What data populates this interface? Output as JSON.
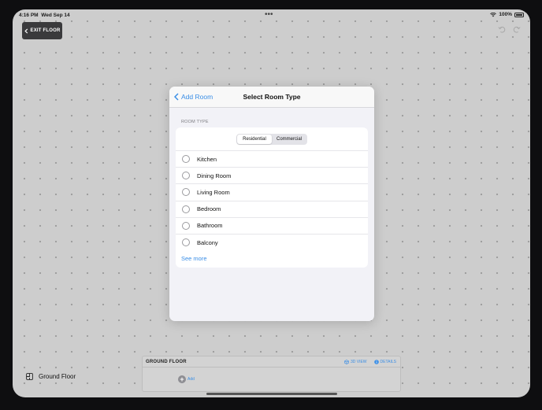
{
  "status_bar": {
    "time": "4:16 PM",
    "date": "Wed Sep 14",
    "battery": "100%",
    "dots": "•••"
  },
  "toolbar": {
    "exit_label": "EXIT FLOOR"
  },
  "dialog": {
    "back_label": "Add Room",
    "title": "Select Room Type",
    "section_label": "ROOM TYPE",
    "segments": [
      {
        "label": "Residential",
        "selected": true
      },
      {
        "label": "Commercial",
        "selected": false
      }
    ],
    "options": [
      {
        "label": "Kitchen",
        "selected": false
      },
      {
        "label": "Dining Room",
        "selected": false
      },
      {
        "label": "Living Room",
        "selected": false
      },
      {
        "label": "Bedroom",
        "selected": false
      },
      {
        "label": "Bathroom",
        "selected": false
      },
      {
        "label": "Balcony",
        "selected": false
      }
    ],
    "see_more": "See more"
  },
  "floor": {
    "label": "Ground Floor",
    "panel_title": "GROUND FLOOR",
    "view_3d": "3D VIEW",
    "details": "DETAILS",
    "add": "Add"
  },
  "colors": {
    "accent": "#3a8ee6",
    "canvas": "#cdcdcd",
    "dialog_bg": "#f2f2f7",
    "exit_button": "#3a3a3c"
  }
}
